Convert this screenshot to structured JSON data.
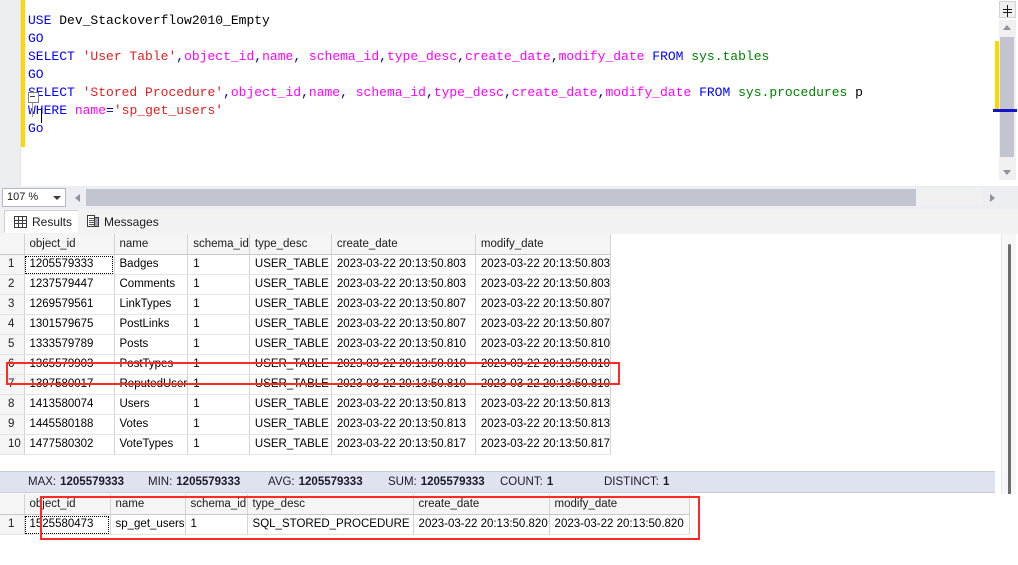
{
  "editor": {
    "zoom_level": "107 %",
    "lines": [
      {
        "segments": [
          {
            "t": "USE",
            "c": "k"
          },
          {
            "t": " ",
            "c": "txt"
          },
          {
            "t": "Dev_Stackoverflow2010_Empty",
            "c": "txt"
          }
        ]
      },
      {
        "segments": [
          {
            "t": "GO",
            "c": "k"
          }
        ]
      },
      {
        "segments": [
          {
            "t": "SELECT",
            "c": "k"
          },
          {
            "t": " ",
            "c": "txt"
          },
          {
            "t": "'User Table'",
            "c": "str"
          },
          {
            "t": ",",
            "c": "pl"
          },
          {
            "t": "object_id",
            "c": "id"
          },
          {
            "t": ",",
            "c": "pl"
          },
          {
            "t": "name",
            "c": "id"
          },
          {
            "t": ", ",
            "c": "pl"
          },
          {
            "t": "schema_id",
            "c": "id"
          },
          {
            "t": ",",
            "c": "pl"
          },
          {
            "t": "type_desc",
            "c": "id"
          },
          {
            "t": ",",
            "c": "pl"
          },
          {
            "t": "create_date",
            "c": "id"
          },
          {
            "t": ",",
            "c": "pl"
          },
          {
            "t": "modify_date",
            "c": "id"
          },
          {
            "t": " ",
            "c": "txt"
          },
          {
            "t": "FROM",
            "c": "k"
          },
          {
            "t": " ",
            "c": "txt"
          },
          {
            "t": "sys.tables",
            "c": "obj"
          }
        ]
      },
      {
        "segments": [
          {
            "t": "GO",
            "c": "k"
          }
        ]
      },
      {
        "segments": [
          {
            "t": "SELECT",
            "c": "k"
          },
          {
            "t": " ",
            "c": "txt"
          },
          {
            "t": "'Stored Procedure'",
            "c": "str"
          },
          {
            "t": ",",
            "c": "pl"
          },
          {
            "t": "object_id",
            "c": "id"
          },
          {
            "t": ",",
            "c": "pl"
          },
          {
            "t": "name",
            "c": "id"
          },
          {
            "t": ", ",
            "c": "pl"
          },
          {
            "t": "schema_id",
            "c": "id"
          },
          {
            "t": ",",
            "c": "pl"
          },
          {
            "t": "type_desc",
            "c": "id"
          },
          {
            "t": ",",
            "c": "pl"
          },
          {
            "t": "create_date",
            "c": "id"
          },
          {
            "t": ",",
            "c": "pl"
          },
          {
            "t": "modify_date",
            "c": "id"
          },
          {
            "t": " ",
            "c": "txt"
          },
          {
            "t": "FROM",
            "c": "k"
          },
          {
            "t": " ",
            "c": "txt"
          },
          {
            "t": "sys.procedures",
            "c": "obj"
          },
          {
            "t": " p",
            "c": "txt"
          }
        ]
      },
      {
        "segments": [
          {
            "t": "WHERE",
            "c": "k"
          },
          {
            "t": " ",
            "c": "txt"
          },
          {
            "t": "name",
            "c": "id"
          },
          {
            "t": "=",
            "c": "pl"
          },
          {
            "t": "'sp_get_users'",
            "c": "str"
          }
        ]
      },
      {
        "segments": [
          {
            "t": "Go",
            "c": "k"
          }
        ]
      }
    ]
  },
  "tabs": {
    "results_label": "Results",
    "messages_label": "Messages",
    "results_icon": "grid-icon",
    "messages_icon": "messages-icon"
  },
  "results_grid": {
    "columns": [
      "object_id",
      "name",
      "schema_id",
      "type_desc",
      "create_date",
      "modify_date"
    ],
    "rows": [
      {
        "n": "1",
        "object_id": "1205579333",
        "name": "Badges",
        "schema_id": "1",
        "type_desc": "USER_TABLE",
        "create_date": "2023-03-22 20:13:50.803",
        "modify_date": "2023-03-22 20:13:50.803"
      },
      {
        "n": "2",
        "object_id": "1237579447",
        "name": "Comments",
        "schema_id": "1",
        "type_desc": "USER_TABLE",
        "create_date": "2023-03-22 20:13:50.803",
        "modify_date": "2023-03-22 20:13:50.803"
      },
      {
        "n": "3",
        "object_id": "1269579561",
        "name": "LinkTypes",
        "schema_id": "1",
        "type_desc": "USER_TABLE",
        "create_date": "2023-03-22 20:13:50.807",
        "modify_date": "2023-03-22 20:13:50.807"
      },
      {
        "n": "4",
        "object_id": "1301579675",
        "name": "PostLinks",
        "schema_id": "1",
        "type_desc": "USER_TABLE",
        "create_date": "2023-03-22 20:13:50.807",
        "modify_date": "2023-03-22 20:13:50.807"
      },
      {
        "n": "5",
        "object_id": "1333579789",
        "name": "Posts",
        "schema_id": "1",
        "type_desc": "USER_TABLE",
        "create_date": "2023-03-22 20:13:50.810",
        "modify_date": "2023-03-22 20:13:50.810"
      },
      {
        "n": "6",
        "object_id": "1365579903",
        "name": "PostTypes",
        "schema_id": "1",
        "type_desc": "USER_TABLE",
        "create_date": "2023-03-22 20:13:50.810",
        "modify_date": "2023-03-22 20:13:50.810"
      },
      {
        "n": "7",
        "object_id": "1397580017",
        "name": "ReputedUser",
        "schema_id": "1",
        "type_desc": "USER_TABLE",
        "create_date": "2023-03-22 20:13:50.810",
        "modify_date": "2023-03-22 20:13:50.810"
      },
      {
        "n": "8",
        "object_id": "1413580074",
        "name": "Users",
        "schema_id": "1",
        "type_desc": "USER_TABLE",
        "create_date": "2023-03-22 20:13:50.813",
        "modify_date": "2023-03-22 20:13:50.813"
      },
      {
        "n": "9",
        "object_id": "1445580188",
        "name": "Votes",
        "schema_id": "1",
        "type_desc": "USER_TABLE",
        "create_date": "2023-03-22 20:13:50.813",
        "modify_date": "2023-03-22 20:13:50.813"
      },
      {
        "n": "10",
        "object_id": "1477580302",
        "name": "VoteTypes",
        "schema_id": "1",
        "type_desc": "USER_TABLE",
        "create_date": "2023-03-22 20:13:50.817",
        "modify_date": "2023-03-22 20:13:50.817"
      }
    ],
    "selected_cell": {
      "row": 1,
      "column": "object_id"
    },
    "highlighted_row": 7
  },
  "aggregate_bar": {
    "items": [
      {
        "label": "MAX:",
        "value": "1205579333"
      },
      {
        "label": "MIN:",
        "value": "1205579333"
      },
      {
        "label": "AVG:",
        "value": "1205579333"
      },
      {
        "label": "SUM:",
        "value": "1205579333"
      },
      {
        "label": "COUNT:",
        "value": "1"
      },
      {
        "label": "DISTINCT:",
        "value": "1"
      }
    ]
  },
  "results_grid2": {
    "columns": [
      "object_id",
      "name",
      "schema_id",
      "type_desc",
      "create_date",
      "modify_date"
    ],
    "rows": [
      {
        "n": "1",
        "object_id": "1525580473",
        "name": "sp_get_users",
        "schema_id": "1",
        "type_desc": "SQL_STORED_PROCEDURE",
        "create_date": "2023-03-22 20:13:50.820",
        "modify_date": "2023-03-22 20:13:50.820"
      }
    ],
    "selected_cell": {
      "row": 1,
      "column": "object_id"
    }
  },
  "colors": {
    "highlight_red": "#ff2a20",
    "keyword_blue": "#0000ff",
    "string_red": "#e02020",
    "identifier_magenta": "#ff00ff",
    "object_green": "#008000",
    "change_bar_yellow": "#ffd700",
    "agg_bar_bg": "#dfe3f0"
  }
}
